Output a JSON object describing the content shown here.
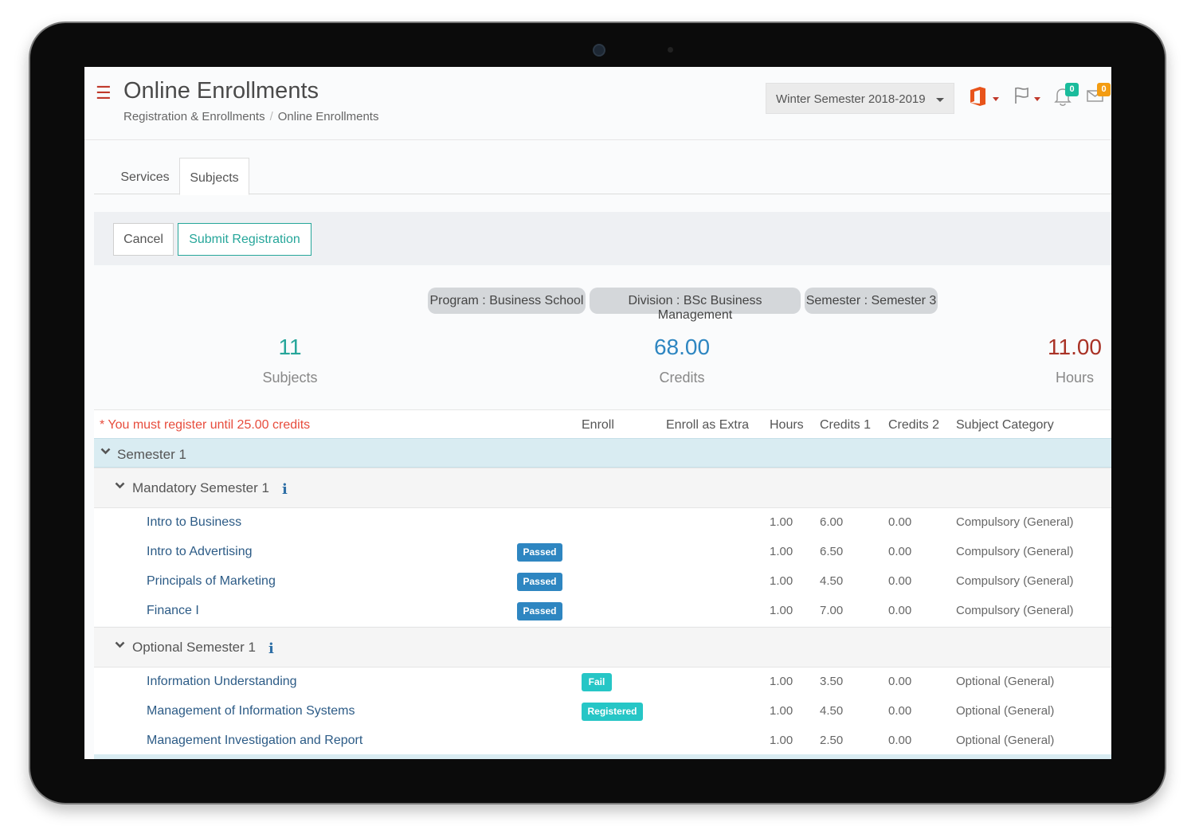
{
  "header": {
    "title": "Online Enrollments",
    "breadcrumb": [
      "Registration & Enrollments",
      "Online Enrollments"
    ],
    "semester_select": "Winter Semester 2018-2019",
    "notifications_count": "0",
    "messages_count": "0",
    "colors": {
      "accent_red": "#c0392b",
      "office_orange": "#e8541b"
    }
  },
  "tabs": [
    {
      "label": "Services",
      "active": false
    },
    {
      "label": "Subjects",
      "active": true
    }
  ],
  "actions": {
    "cancel": "Cancel",
    "submit": "Submit Registration"
  },
  "pills": {
    "program": "Program :  Business School",
    "division": "Division :  BSc Business Management",
    "semester": "Semester : Semester 3"
  },
  "stats": {
    "subjects": {
      "value": "11",
      "label": "Subjects",
      "color": "#26a69a"
    },
    "credits": {
      "value": "68.00",
      "label": "Credits",
      "color": "#2e86c1"
    },
    "hours": {
      "value": "11.00",
      "label": "Hours",
      "color": "#a93226"
    }
  },
  "table": {
    "warning": "* You must register until 25.00 credits",
    "columns": [
      "Enroll",
      "Enroll as Extra",
      "Hours",
      "Credits 1",
      "Credits 2",
      "Subject Category"
    ],
    "semester_label": "Semester 1",
    "groups": [
      {
        "label": "Mandatory Semester 1",
        "rows": [
          {
            "name": "Intro to Business",
            "status": "",
            "hours": "1.00",
            "credits1": "6.00",
            "credits2": "0.00",
            "category": "Compulsory (General)"
          },
          {
            "name": "Intro to Advertising",
            "status": "Passed",
            "hours": "1.00",
            "credits1": "6.50",
            "credits2": "0.00",
            "category": "Compulsory (General)"
          },
          {
            "name": "Principals of Marketing",
            "status": "Passed",
            "hours": "1.00",
            "credits1": "4.50",
            "credits2": "0.00",
            "category": "Compulsory (General)"
          },
          {
            "name": "Finance I",
            "status": "Passed",
            "hours": "1.00",
            "credits1": "7.00",
            "credits2": "0.00",
            "category": "Compulsory (General)"
          }
        ]
      },
      {
        "label": "Optional Semester 1",
        "rows": [
          {
            "name": "Information Understanding",
            "status": "Fail",
            "hours": "1.00",
            "credits1": "3.50",
            "credits2": "0.00",
            "category": "Optional (General)"
          },
          {
            "name": "Management of Information Systems",
            "status": "Registered",
            "hours": "1.00",
            "credits1": "4.50",
            "credits2": "0.00",
            "category": "Optional (General)"
          },
          {
            "name": "Management Investigation and Report",
            "status": "",
            "hours": "1.00",
            "credits1": "2.50",
            "credits2": "0.00",
            "category": "Optional (General)"
          }
        ]
      }
    ],
    "info_symbol": "i"
  }
}
